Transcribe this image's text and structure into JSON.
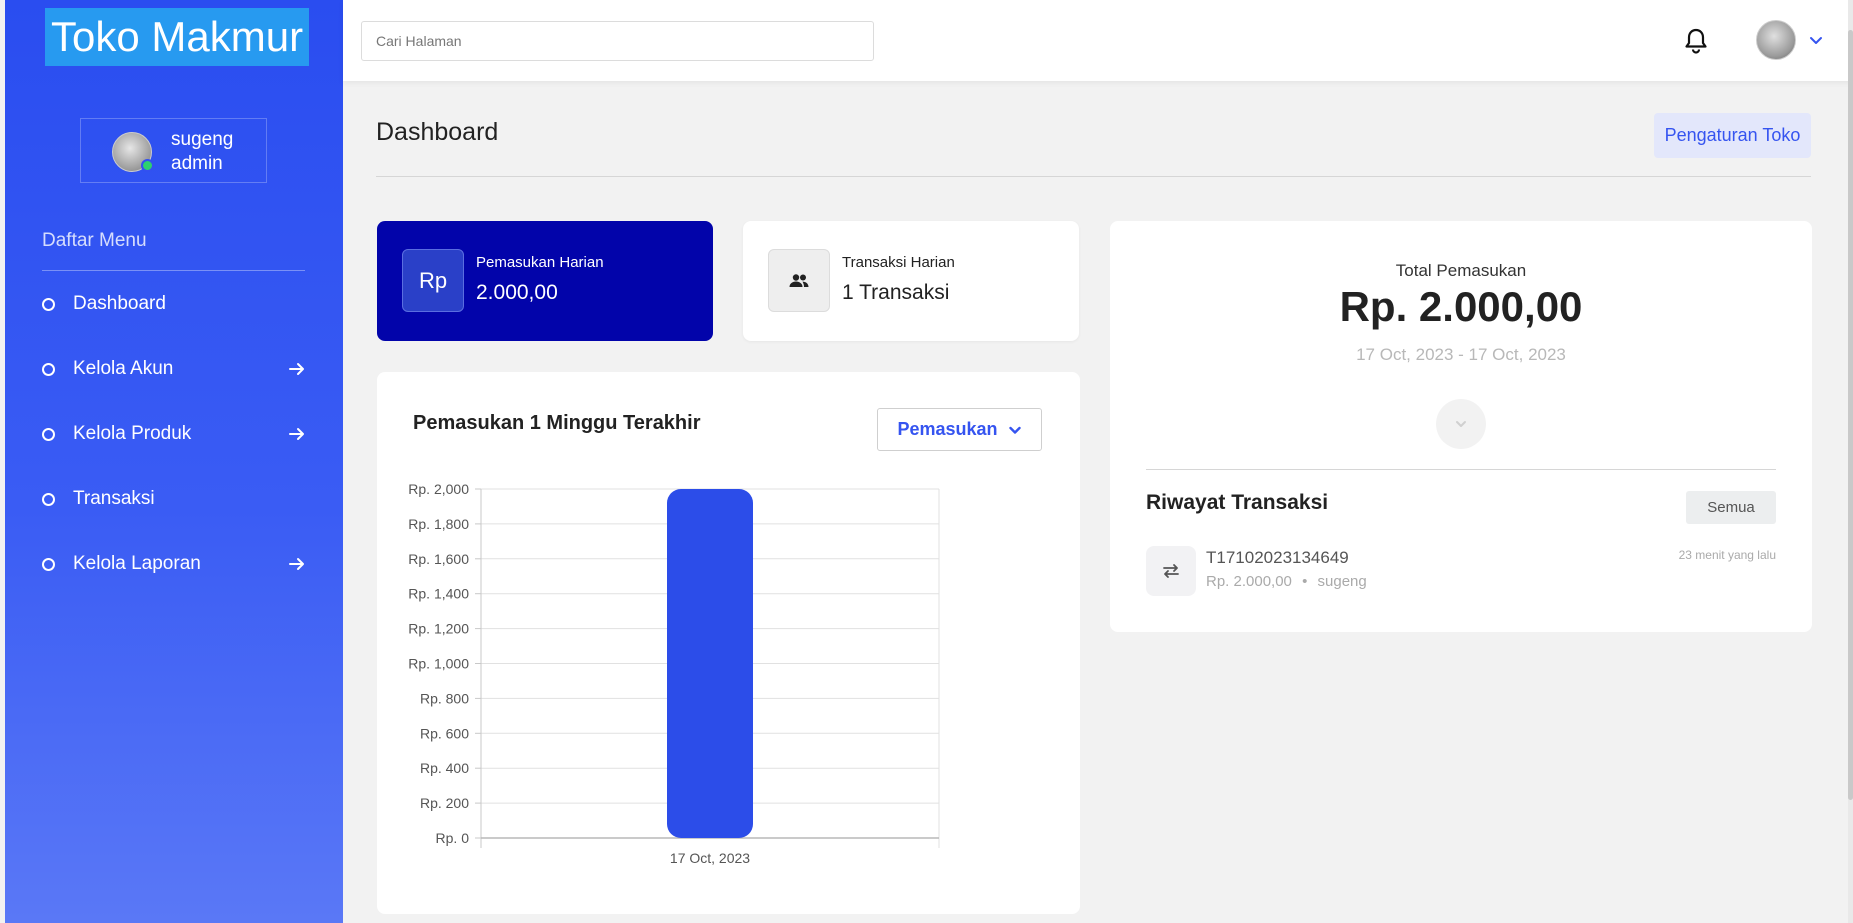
{
  "sidebar": {
    "brand": "Toko Makmur",
    "user": {
      "name": "sugeng",
      "role": "admin"
    },
    "menu_heading": "Daftar Menu",
    "items": [
      {
        "label": "Dashboard"
      },
      {
        "label": "Kelola Akun"
      },
      {
        "label": "Kelola Produk"
      },
      {
        "label": "Transaksi"
      },
      {
        "label": "Kelola Laporan"
      }
    ]
  },
  "topbar": {
    "search_placeholder": "Cari Halaman"
  },
  "header": {
    "title": "Dashboard",
    "settings_button": "Pengaturan Toko"
  },
  "stats": [
    {
      "label": "Pemasukan Harian",
      "value": "2.000,00",
      "icon_text": "Rp"
    },
    {
      "label": "Transaksi Harian",
      "value": "1 Transaksi",
      "icon": "users-icon"
    }
  ],
  "chart_card": {
    "title": "Pemasukan 1 Minggu Terakhir",
    "select_label": "Pemasukan"
  },
  "chart_data": {
    "type": "bar",
    "title": "Pemasukan 1 Minggu Terakhir",
    "categories": [
      "17 Oct, 2023"
    ],
    "values": [
      2000
    ],
    "ylim": [
      0,
      2000
    ],
    "ytick_values": [
      0,
      200,
      400,
      600,
      800,
      1000,
      1200,
      1400,
      1600,
      1800,
      2000
    ],
    "ytick_labels": [
      "Rp. 0",
      "Rp. 200",
      "Rp. 400",
      "Rp. 600",
      "Rp. 800",
      "Rp. 1,000",
      "Rp. 1,200",
      "Rp. 1,400",
      "Rp. 1,600",
      "Rp. 1,800",
      "Rp. 2,000"
    ],
    "grid": true,
    "bar_color": "#2c4de9"
  },
  "summary": {
    "label": "Total Pemasukan",
    "value": "Rp. 2.000,00",
    "range": "17 Oct, 2023 - 17 Oct, 2023"
  },
  "history": {
    "title": "Riwayat Transaksi",
    "all_button": "Semua",
    "items": [
      {
        "id": "T17102023134649",
        "amount": "Rp. 2.000,00",
        "user": "sugeng",
        "time": "23 menit yang lalu"
      }
    ]
  },
  "colors": {
    "accent": "#3554f0",
    "sidebar_top": "#2a4df0",
    "stat_primary": "#0204aa",
    "online": "#2ed06e"
  }
}
